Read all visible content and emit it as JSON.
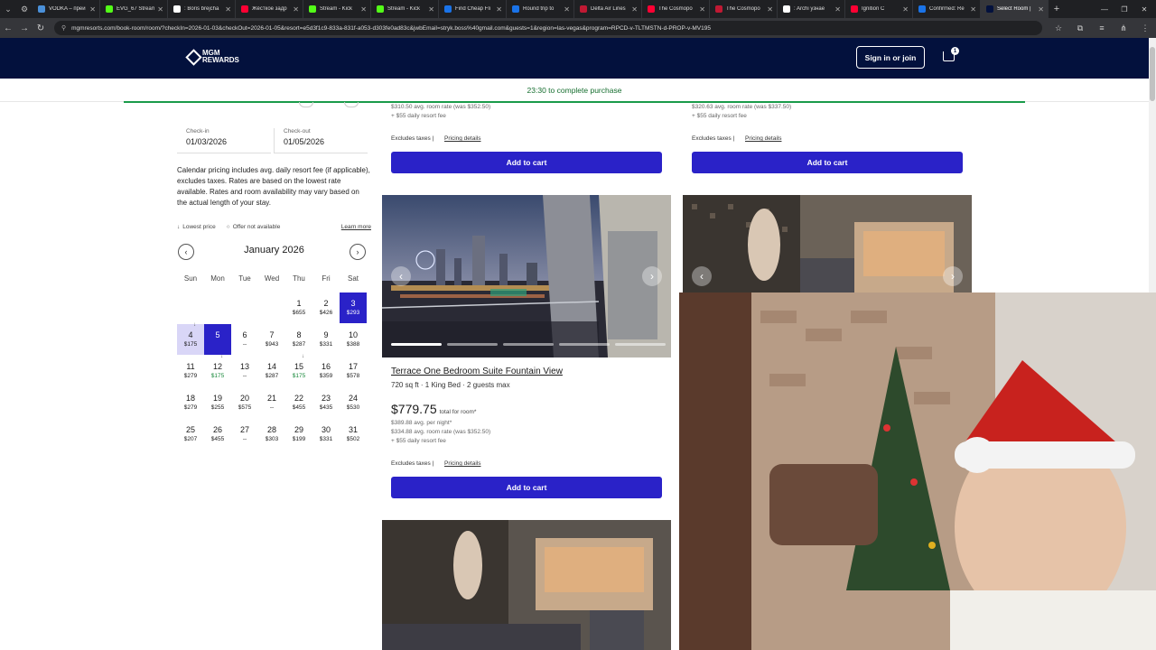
{
  "browser": {
    "tabs": [
      {
        "title": "VODKA – преи",
        "color": "#4a90d9"
      },
      {
        "title": "EVG_67 Stream",
        "color": "#53fc18"
      },
      {
        "title": ": Boris brejcha",
        "color": "#ffffff"
      },
      {
        "title": "Жёсткое задр",
        "color": "#ff0033"
      },
      {
        "title": "Stream - Kick",
        "color": "#53fc18"
      },
      {
        "title": "Stream - Kick",
        "color": "#53fc18"
      },
      {
        "title": "Find Cheap Fli",
        "color": "#1a73e8"
      },
      {
        "title": "Round trip to",
        "color": "#1a73e8"
      },
      {
        "title": "Delta Air Lines",
        "color": "#c01933"
      },
      {
        "title": "The Cosmopo",
        "color": "#ff0033"
      },
      {
        "title": "The Cosmopo",
        "color": "#c01933"
      },
      {
        "title": ": Archi узнае",
        "color": "#ffffff"
      },
      {
        "title": "Ignition C",
        "color": "#ff0033"
      },
      {
        "title": "Confirmed: Re",
        "color": "#1a73e8"
      },
      {
        "title": "Select Room |",
        "color": "#03113d"
      }
    ],
    "url": "mgmresorts.com/book-room/room/?checkIn=2026-01-03&checkOut=2026-01-05&resort=e5d3f1c9-833a-831f-a053-d303fe0ad83c&jwbEmail=stryk.boss%40gmail.com&guests=1&region=las-vegas&program=RPCD-v-TLTMSTN-d-PROP-v-MV195"
  },
  "header": {
    "logo_text": "MGM\nREWARDS",
    "signin_label": "Sign in or join",
    "cart_count": "1"
  },
  "timer": {
    "text": "23:30 to complete purchase"
  },
  "booking": {
    "checkin_label": "Check-in",
    "checkin_value": "01/03/2026",
    "checkout_label": "Check-out",
    "checkout_value": "01/05/2026",
    "note": "Calendar pricing includes avg. daily resort fee (if applicable), excludes taxes. Rates are based on the lowest rate available. Rates and room availability may vary based on the actual length of your stay.",
    "legend_lowest": "Lowest price",
    "legend_unavailable": "Offer not available",
    "learn_more": "Learn more",
    "month": "January 2026",
    "weekdays": [
      "Sun",
      "Mon",
      "Tue",
      "Wed",
      "Thu",
      "Fri",
      "Sat"
    ],
    "days": [
      {
        "d": "1",
        "p": "$655"
      },
      {
        "d": "2",
        "p": "$426"
      },
      {
        "d": "3",
        "p": "$293"
      },
      {
        "d": "4",
        "p": "$175"
      },
      {
        "d": "5",
        "p": ""
      },
      {
        "d": "6",
        "p": "--"
      },
      {
        "d": "7",
        "p": "$943"
      },
      {
        "d": "8",
        "p": "$287"
      },
      {
        "d": "9",
        "p": "$331"
      },
      {
        "d": "10",
        "p": "$388"
      },
      {
        "d": "11",
        "p": "$279"
      },
      {
        "d": "12",
        "p": "$175"
      },
      {
        "d": "13",
        "p": "--"
      },
      {
        "d": "14",
        "p": "$287"
      },
      {
        "d": "15",
        "p": "$175"
      },
      {
        "d": "16",
        "p": "$359"
      },
      {
        "d": "17",
        "p": "$578"
      },
      {
        "d": "18",
        "p": "$279"
      },
      {
        "d": "19",
        "p": "$255"
      },
      {
        "d": "20",
        "p": "$575"
      },
      {
        "d": "21",
        "p": "--"
      },
      {
        "d": "22",
        "p": "$455"
      },
      {
        "d": "23",
        "p": "$435"
      },
      {
        "d": "24",
        "p": "$530"
      },
      {
        "d": "25",
        "p": "$207"
      },
      {
        "d": "26",
        "p": "$455"
      },
      {
        "d": "27",
        "p": "--"
      },
      {
        "d": "28",
        "p": "$303"
      },
      {
        "d": "29",
        "p": "$199"
      },
      {
        "d": "30",
        "p": "$331"
      },
      {
        "d": "31",
        "p": "$502"
      }
    ]
  },
  "rooms": {
    "top_left": {
      "rate": "$310.50 avg. room rate (was $352.50)",
      "fee": "+ $55 daily resort fee",
      "taxes": "Excludes taxes |",
      "pricing": "Pricing details",
      "cta": "Add to cart"
    },
    "top_right": {
      "rate": "$320.63 avg. room rate (was $337.50)",
      "fee": "+ $55 daily resort fee",
      "taxes": "Excludes taxes |",
      "pricing": "Pricing details",
      "cta": "Add to cart"
    },
    "featured": {
      "title": "Terrace One Bedroom Suite Fountain View",
      "info": "720 sq ft · 1 King Bed · 2 guests max",
      "price": "$779.75",
      "price_suffix": "total for room*",
      "avg_night": "$389.88 avg. per night*",
      "rate": "$334.88 avg. room rate (was $352.50)",
      "fee": "+ $55 daily resort fee",
      "taxes": "Excludes taxes |",
      "pricing": "Pricing details",
      "cta": "Add to cart"
    }
  },
  "colors": {
    "brand_navy": "#03113d",
    "cta": "#2a22c8",
    "timer_green": "#1a9b4a"
  }
}
